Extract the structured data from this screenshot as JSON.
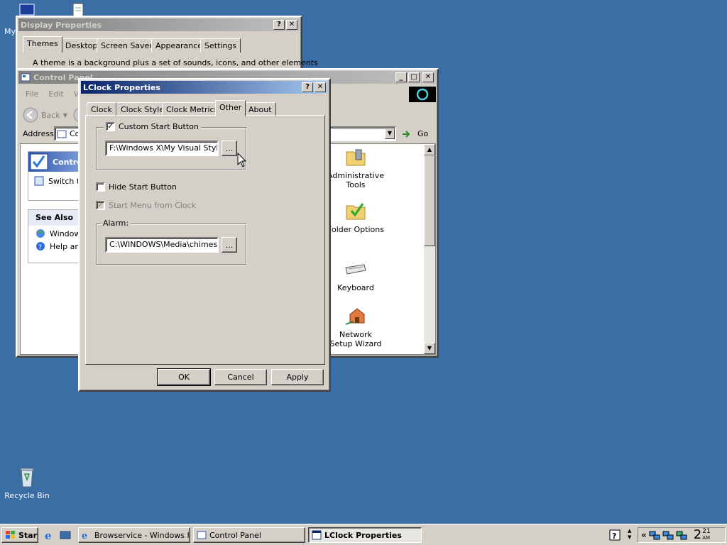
{
  "desktop": {
    "icons": [
      {
        "label": "My"
      },
      {
        "label": "Recycle Bin"
      }
    ],
    "background": "#3a6ea5"
  },
  "display_properties": {
    "title": "Display Properties",
    "tabs": [
      "Themes",
      "Desktop",
      "Screen Saver",
      "Appearance",
      "Settings"
    ],
    "selected_tab": "Themes",
    "description": "A theme is a background plus a set of sounds, icons, and other elements"
  },
  "control_panel": {
    "title": "Control Panel",
    "menu": [
      "File",
      "Edit",
      "V"
    ],
    "back_label": "Back",
    "address_label": "Address",
    "address_value": "Co",
    "go_label": "Go",
    "side_title": "Contro",
    "switch_label": "Switch t",
    "see_also": "See Also",
    "see_also_items": [
      "Window",
      "Help and"
    ],
    "items": [
      {
        "label": "Administrative Tools",
        "icon": "folder-tools-icon"
      },
      {
        "label": "Folder Options",
        "icon": "folder-check-icon"
      },
      {
        "label": "Keyboard",
        "icon": "keyboard-icon"
      },
      {
        "label": "Network Setup Wizard",
        "icon": "network-house-icon"
      }
    ]
  },
  "lclock": {
    "title": "LClock Properties",
    "tabs": [
      "Clock",
      "Clock Style",
      "Clock Metrics",
      "Other",
      "About"
    ],
    "selected_tab": "Other",
    "custom_start": {
      "label": "Custom Start Button",
      "checked": "✓",
      "path": "F:\\Windows X\\My Visual Styles'",
      "browse": "..."
    },
    "hide_start": {
      "label": "Hide Start Button",
      "checked": ""
    },
    "start_menu_clock": {
      "label": "Start Menu from Clock",
      "checked": "✓"
    },
    "alarm": {
      "label": "Alarm:",
      "path": "C:\\WINDOWS\\Media\\chimes.w",
      "browse": "..."
    },
    "ok": "OK",
    "cancel": "Cancel",
    "apply": "Apply"
  },
  "taskbar": {
    "start": "Start",
    "tasks": [
      {
        "label": "Browservice - Windows I..."
      },
      {
        "label": "Control Panel"
      },
      {
        "label": "LClock Properties"
      }
    ],
    "tray_chevron": "«",
    "clock_hour": "2",
    "clock_min": "21",
    "clock_ampm": "AM"
  }
}
